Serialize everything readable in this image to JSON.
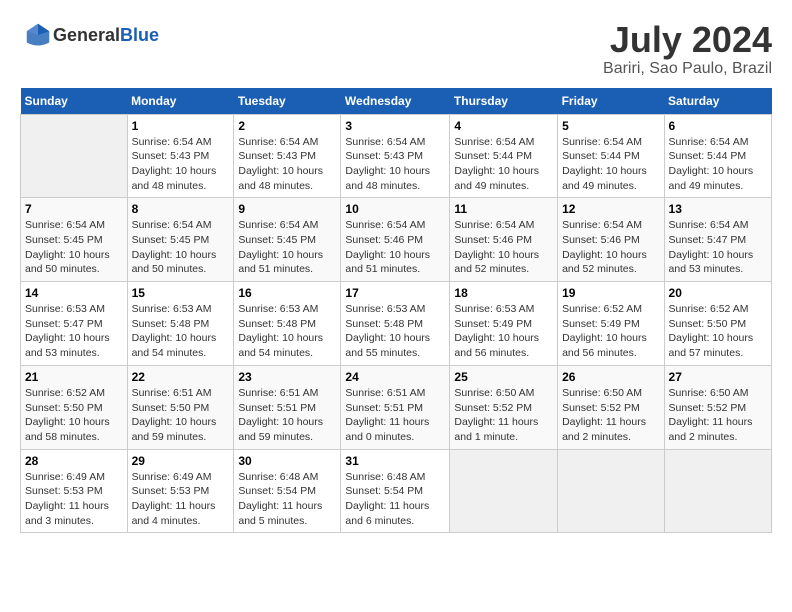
{
  "header": {
    "logo_general": "General",
    "logo_blue": "Blue",
    "title": "July 2024",
    "subtitle": "Bariri, Sao Paulo, Brazil"
  },
  "calendar": {
    "days": [
      "Sunday",
      "Monday",
      "Tuesday",
      "Wednesday",
      "Thursday",
      "Friday",
      "Saturday"
    ],
    "weeks": [
      [
        {
          "date": "",
          "info": ""
        },
        {
          "date": "1",
          "info": "Sunrise: 6:54 AM\nSunset: 5:43 PM\nDaylight: 10 hours\nand 48 minutes."
        },
        {
          "date": "2",
          "info": "Sunrise: 6:54 AM\nSunset: 5:43 PM\nDaylight: 10 hours\nand 48 minutes."
        },
        {
          "date": "3",
          "info": "Sunrise: 6:54 AM\nSunset: 5:43 PM\nDaylight: 10 hours\nand 48 minutes."
        },
        {
          "date": "4",
          "info": "Sunrise: 6:54 AM\nSunset: 5:44 PM\nDaylight: 10 hours\nand 49 minutes."
        },
        {
          "date": "5",
          "info": "Sunrise: 6:54 AM\nSunset: 5:44 PM\nDaylight: 10 hours\nand 49 minutes."
        },
        {
          "date": "6",
          "info": "Sunrise: 6:54 AM\nSunset: 5:44 PM\nDaylight: 10 hours\nand 49 minutes."
        }
      ],
      [
        {
          "date": "7",
          "info": "Sunrise: 6:54 AM\nSunset: 5:45 PM\nDaylight: 10 hours\nand 50 minutes."
        },
        {
          "date": "8",
          "info": "Sunrise: 6:54 AM\nSunset: 5:45 PM\nDaylight: 10 hours\nand 50 minutes."
        },
        {
          "date": "9",
          "info": "Sunrise: 6:54 AM\nSunset: 5:45 PM\nDaylight: 10 hours\nand 51 minutes."
        },
        {
          "date": "10",
          "info": "Sunrise: 6:54 AM\nSunset: 5:46 PM\nDaylight: 10 hours\nand 51 minutes."
        },
        {
          "date": "11",
          "info": "Sunrise: 6:54 AM\nSunset: 5:46 PM\nDaylight: 10 hours\nand 52 minutes."
        },
        {
          "date": "12",
          "info": "Sunrise: 6:54 AM\nSunset: 5:46 PM\nDaylight: 10 hours\nand 52 minutes."
        },
        {
          "date": "13",
          "info": "Sunrise: 6:54 AM\nSunset: 5:47 PM\nDaylight: 10 hours\nand 53 minutes."
        }
      ],
      [
        {
          "date": "14",
          "info": "Sunrise: 6:53 AM\nSunset: 5:47 PM\nDaylight: 10 hours\nand 53 minutes."
        },
        {
          "date": "15",
          "info": "Sunrise: 6:53 AM\nSunset: 5:48 PM\nDaylight: 10 hours\nand 54 minutes."
        },
        {
          "date": "16",
          "info": "Sunrise: 6:53 AM\nSunset: 5:48 PM\nDaylight: 10 hours\nand 54 minutes."
        },
        {
          "date": "17",
          "info": "Sunrise: 6:53 AM\nSunset: 5:48 PM\nDaylight: 10 hours\nand 55 minutes."
        },
        {
          "date": "18",
          "info": "Sunrise: 6:53 AM\nSunset: 5:49 PM\nDaylight: 10 hours\nand 56 minutes."
        },
        {
          "date": "19",
          "info": "Sunrise: 6:52 AM\nSunset: 5:49 PM\nDaylight: 10 hours\nand 56 minutes."
        },
        {
          "date": "20",
          "info": "Sunrise: 6:52 AM\nSunset: 5:50 PM\nDaylight: 10 hours\nand 57 minutes."
        }
      ],
      [
        {
          "date": "21",
          "info": "Sunrise: 6:52 AM\nSunset: 5:50 PM\nDaylight: 10 hours\nand 58 minutes."
        },
        {
          "date": "22",
          "info": "Sunrise: 6:51 AM\nSunset: 5:50 PM\nDaylight: 10 hours\nand 59 minutes."
        },
        {
          "date": "23",
          "info": "Sunrise: 6:51 AM\nSunset: 5:51 PM\nDaylight: 10 hours\nand 59 minutes."
        },
        {
          "date": "24",
          "info": "Sunrise: 6:51 AM\nSunset: 5:51 PM\nDaylight: 11 hours\nand 0 minutes."
        },
        {
          "date": "25",
          "info": "Sunrise: 6:50 AM\nSunset: 5:52 PM\nDaylight: 11 hours\nand 1 minute."
        },
        {
          "date": "26",
          "info": "Sunrise: 6:50 AM\nSunset: 5:52 PM\nDaylight: 11 hours\nand 2 minutes."
        },
        {
          "date": "27",
          "info": "Sunrise: 6:50 AM\nSunset: 5:52 PM\nDaylight: 11 hours\nand 2 minutes."
        }
      ],
      [
        {
          "date": "28",
          "info": "Sunrise: 6:49 AM\nSunset: 5:53 PM\nDaylight: 11 hours\nand 3 minutes."
        },
        {
          "date": "29",
          "info": "Sunrise: 6:49 AM\nSunset: 5:53 PM\nDaylight: 11 hours\nand 4 minutes."
        },
        {
          "date": "30",
          "info": "Sunrise: 6:48 AM\nSunset: 5:54 PM\nDaylight: 11 hours\nand 5 minutes."
        },
        {
          "date": "31",
          "info": "Sunrise: 6:48 AM\nSunset: 5:54 PM\nDaylight: 11 hours\nand 6 minutes."
        },
        {
          "date": "",
          "info": ""
        },
        {
          "date": "",
          "info": ""
        },
        {
          "date": "",
          "info": ""
        }
      ]
    ]
  }
}
